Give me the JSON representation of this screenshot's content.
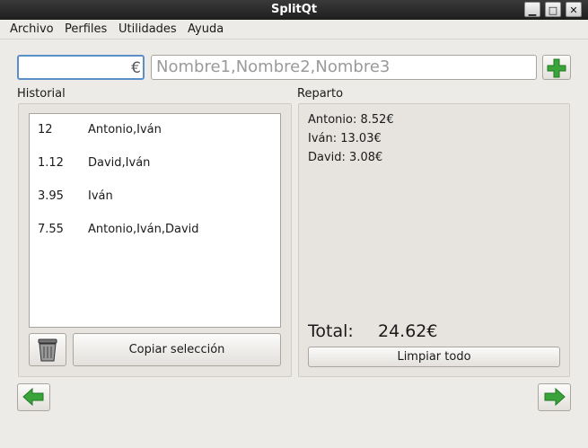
{
  "window": {
    "title": "SplitQt"
  },
  "menu": [
    "Archivo",
    "Perfiles",
    "Utilidades",
    "Ayuda"
  ],
  "inputs": {
    "amount_value": "",
    "currency_symbol": "€",
    "names_placeholder": "Nombre1,Nombre2,Nombre3"
  },
  "labels": {
    "historial": "Historial",
    "reparto": "Reparto"
  },
  "history": [
    {
      "amount": "12",
      "names": "Antonio,Iván"
    },
    {
      "amount": "1.12",
      "names": "David,Iván"
    },
    {
      "amount": "3.95",
      "names": "Iván"
    },
    {
      "amount": "7.55",
      "names": "Antonio,Iván,David"
    }
  ],
  "reparto": [
    "Antonio: 8.52€",
    "Iván: 13.03€",
    "David: 3.08€"
  ],
  "total": {
    "label": "Total:",
    "value": "24.62€"
  },
  "buttons": {
    "copy": "Copiar selección",
    "clear": "Limpiar todo"
  },
  "icons": {
    "add": "plus-icon",
    "delete": "trash-icon",
    "back": "arrow-left-icon",
    "forward": "arrow-right-icon",
    "minimize": "minimize-icon",
    "maximize": "maximize-icon",
    "close": "close-icon"
  },
  "colors": {
    "accent_green": "#3aa33a",
    "focus_blue": "#5b8fc7",
    "titlebar": "#262626"
  }
}
